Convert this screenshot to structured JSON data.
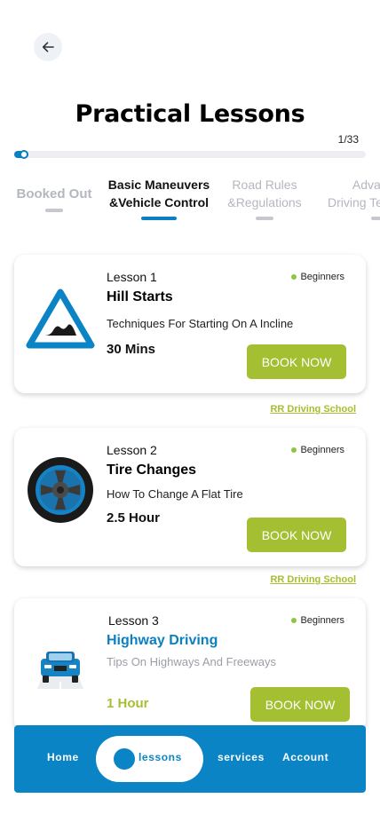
{
  "header": {
    "title": "Practical Lessons",
    "progress_text": "1/33",
    "progress_fraction": 0.04
  },
  "tabs": [
    {
      "label": "Booked Out",
      "active": false
    },
    {
      "label_line1": "Basic Maneuvers",
      "label_line2": "&Vehicle Control",
      "active": true
    },
    {
      "label_line1": "Road Rules",
      "label_line2": "&Regulations",
      "active": false
    },
    {
      "label_line1": "Advanced",
      "label_line2": "Driving Techniques",
      "active": false
    }
  ],
  "lessons": [
    {
      "number": "Lesson 1",
      "level": "Beginners",
      "title": "Hill Starts",
      "description": "Techniques For Starting On A Incline",
      "duration": "30 Mins",
      "button": "BOOK NOW",
      "icon": "hill-road-sign-icon",
      "school": "RR Driving School"
    },
    {
      "number": "Lesson 2",
      "level": "Beginners",
      "title": "Tire Changes",
      "description": "How To Change A Flat Tire",
      "duration": "2.5 Hour",
      "button": "BOOK NOW",
      "icon": "tire-icon",
      "school": "RR Driving School"
    },
    {
      "number": "Lesson 3",
      "level": "Beginners",
      "title": "Highway Driving",
      "description": "Tips On Highways And Freeways",
      "duration": "1 Hour",
      "button": "BOOK NOW",
      "icon": "car-on-highway-icon"
    }
  ],
  "bottom_nav": {
    "home": "Home",
    "lessons": "lessons",
    "services": "services",
    "account": "Account",
    "active": "lessons"
  },
  "colors": {
    "primary_blue": "#0b84c6",
    "accent_green": "#a5bf32",
    "level_dot": "#8dc63f"
  }
}
